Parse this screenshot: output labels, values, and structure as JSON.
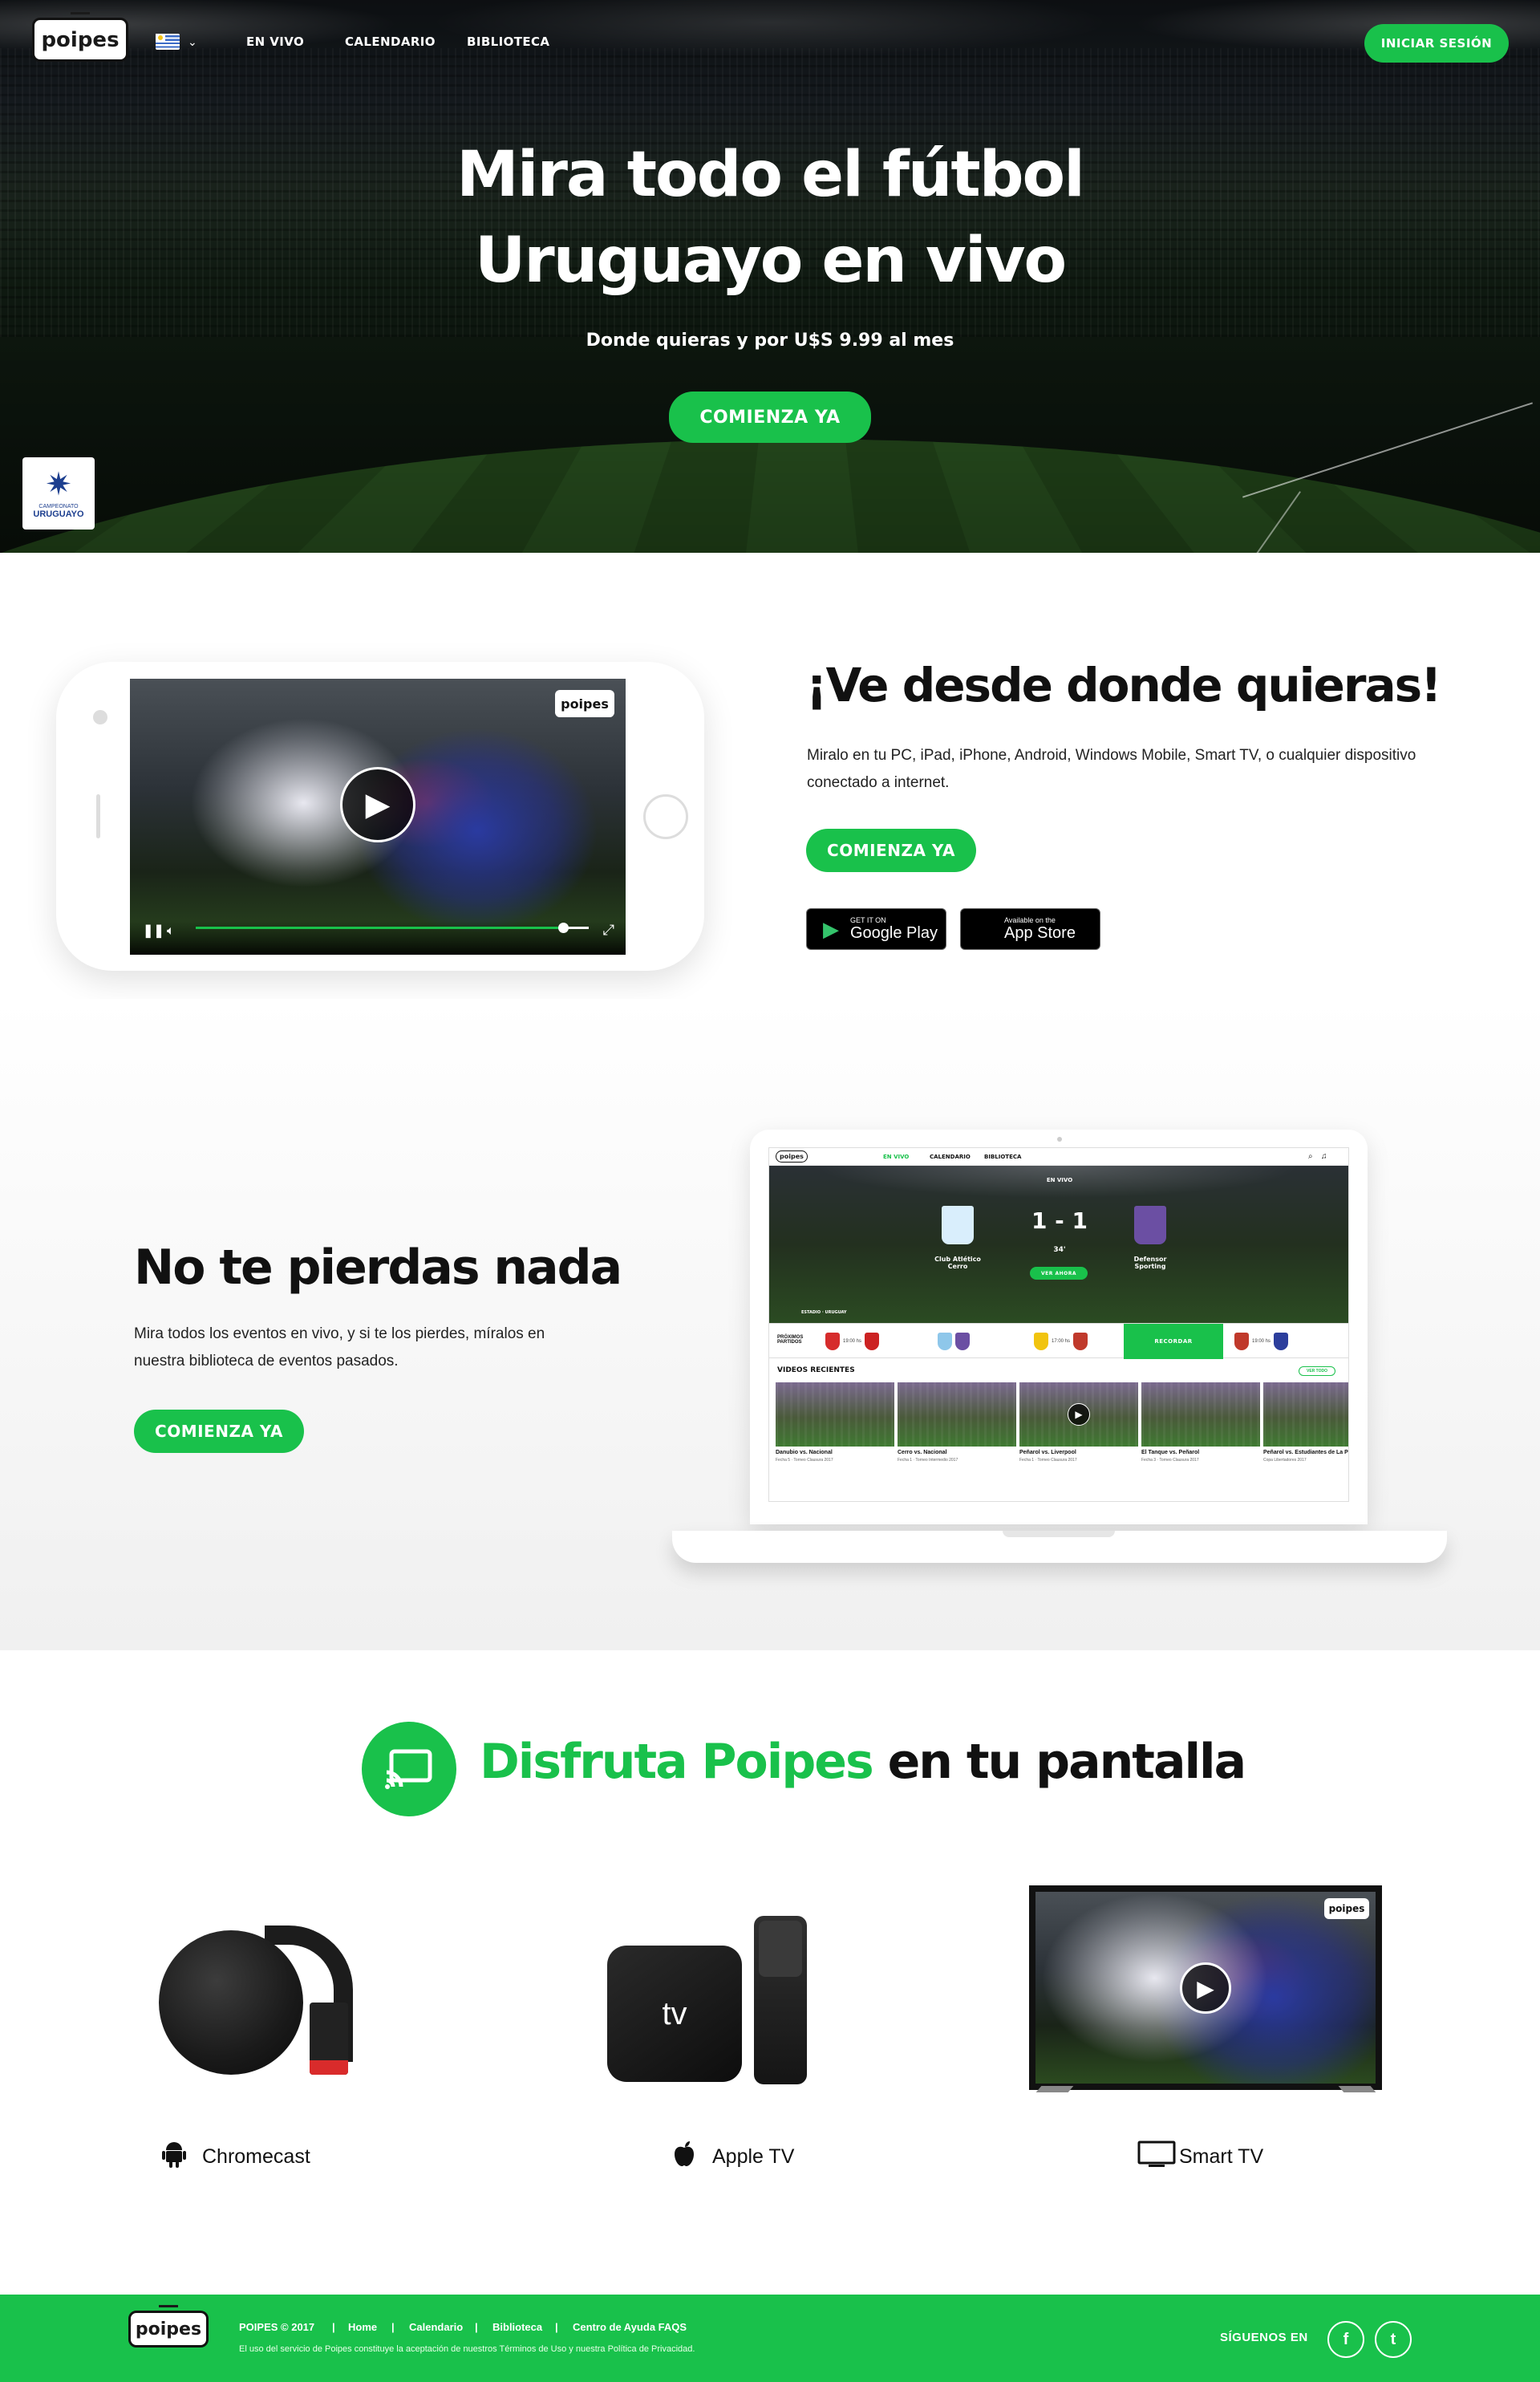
{
  "nav": {
    "logo": "poipes",
    "links": [
      "EN VIVO",
      "CALENDARIO",
      "BIBLIOTECA"
    ],
    "login_label": "INICIAR SESIÓN",
    "country_flag": "uruguay-flag-icon"
  },
  "hero": {
    "title_line1": "Mira todo el fútbol",
    "title_line2": "Uruguayo en vivo",
    "subtitle": "Donde quieras y por U$S 9.99 al mes",
    "cta": "COMIENZA YA",
    "badge_line1": "CAMPEONATO",
    "badge_line2": "URUGUAYO"
  },
  "watch_anywhere": {
    "title": "¡Ve desde donde quieras!",
    "text": "Miralo en tu PC, iPad, iPhone, Android, Windows Mobile, Smart TV, o cualquier dispositivo conectado a internet.",
    "cta": "COMIENZA YA",
    "google_play_small": "GET IT ON",
    "google_play_big": "Google Play",
    "app_store_small": "Available on the",
    "app_store_big": "App Store",
    "video_logo": "poipes"
  },
  "dont_miss": {
    "title": "No te pierdas nada",
    "text": "Mira todos los eventos en vivo, y si te los pierdes, míralos en nuestra biblioteca de eventos pasados.",
    "cta": "COMIENZA YA"
  },
  "laptop_screen": {
    "logo": "poipes",
    "links": [
      "EN VIVO",
      "CALENDARIO",
      "BIBLIOTECA"
    ],
    "live_label": "EN VIVO",
    "score": "1 - 1",
    "minute": "34'",
    "home_team": "Club Atlético Cerro",
    "away_team": "Defensor Sporting",
    "watch_now": "VER AHORA",
    "stadium": "ESTADIO · URUGUAY",
    "next_label": "PRÓXIMOS PARTIDOS",
    "remind_label": "RECORDAR",
    "match_times": [
      "19:00 hs",
      "17:00 hs",
      "19:00 hs"
    ],
    "recent_title": "VIDEOS RECIENTES",
    "see_all": "VER TODO",
    "videos": [
      {
        "title": "Danubio vs. Nacional",
        "sub": "Fecha 5 · Torneo Clausura 2017"
      },
      {
        "title": "Cerro vs. Nacional",
        "sub": "Fecha 1 · Torneo Intermedio 2017"
      },
      {
        "title": "Peñarol vs. Liverpool",
        "sub": "Fecha 1 · Torneo Clausura 2017"
      },
      {
        "title": "El Tanque vs. Peñarol",
        "sub": "Fecha 3 · Torneo Clausura 2017"
      },
      {
        "title": "Peñarol vs. Estudiantes de La P",
        "sub": "Copa Libertadores 2017"
      }
    ]
  },
  "screens": {
    "title_green": "Disfruta Poipes",
    "title_black": "en tu pantalla",
    "devices": [
      {
        "label": "Chromecast",
        "icon": "android-icon"
      },
      {
        "label": "Apple TV",
        "icon": "apple-icon"
      },
      {
        "label": "Smart TV",
        "icon": "tv-icon"
      }
    ],
    "atv_logo": "tv",
    "tv_logo": "poipes"
  },
  "footer": {
    "logo": "poipes",
    "copyright": "POIPES © 2017",
    "links": [
      "Home",
      "Calendario",
      "Biblioteca",
      "Centro de Ayuda FAQS"
    ],
    "separator": "|",
    "legal": "El uso del servicio de Poipes constituye la aceptación de nuestros Términos de Uso y nuestra Política de Privacidad.",
    "follow": "SÍGUENOS EN",
    "social": [
      "f",
      "t"
    ]
  },
  "colors": {
    "brand_green": "#19c14b",
    "dark": "#111111"
  }
}
